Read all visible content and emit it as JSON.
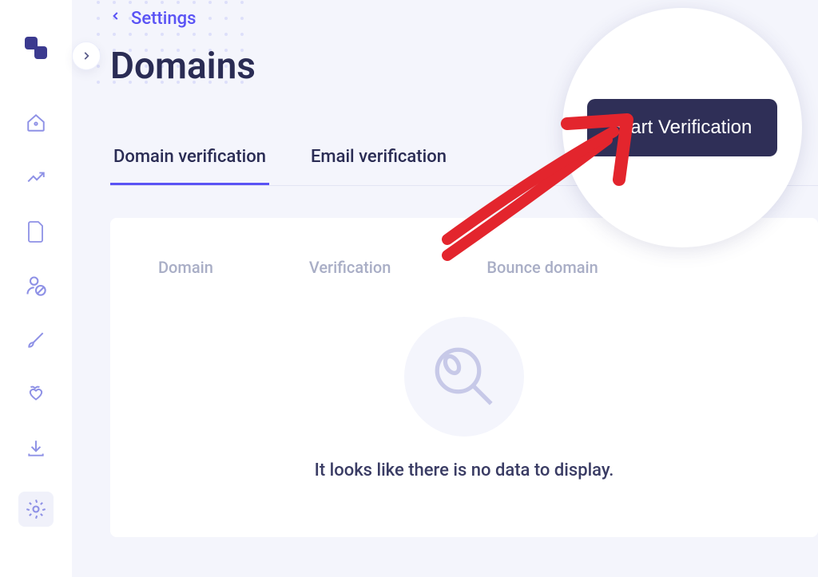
{
  "breadcrumb": {
    "label": "Settings"
  },
  "page": {
    "title": "Domains"
  },
  "action": {
    "start_button": "Start Verification"
  },
  "tabs": [
    {
      "label": "Domain verification",
      "active": true
    },
    {
      "label": "Email verification",
      "active": false
    }
  ],
  "table": {
    "columns": [
      "Domain",
      "Verification",
      "Bounce domain"
    ],
    "empty_message": "It looks like there is no data to display."
  },
  "colors": {
    "accent": "#5a53f5",
    "dark": "#2f2f57",
    "muted": "#a9aec6"
  }
}
